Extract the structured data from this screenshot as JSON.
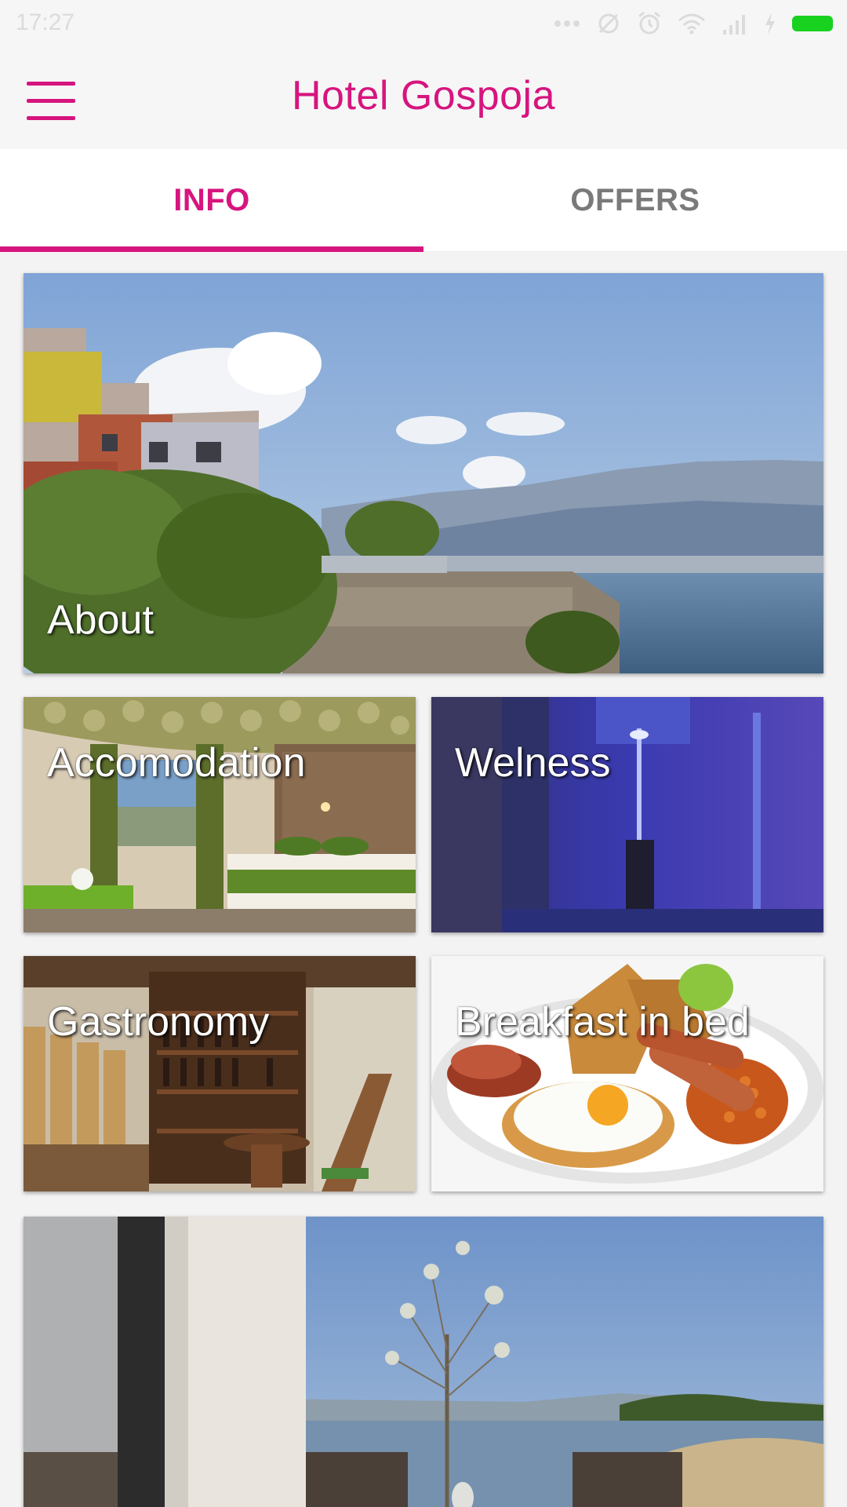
{
  "status_bar": {
    "time": "17:27",
    "icons": [
      "dots-icon",
      "sync-icon",
      "alarm-icon",
      "wifi-icon",
      "signal-icon",
      "charging-icon",
      "battery-icon"
    ],
    "battery_color": "#19d11f"
  },
  "app_bar": {
    "title": "Hotel Gospoja",
    "menu_icon": "hamburger-menu-icon"
  },
  "tabs": [
    {
      "label": "INFO",
      "selected": true
    },
    {
      "label": "OFFERS",
      "selected": false
    }
  ],
  "cards": [
    {
      "label": "About"
    },
    {
      "label": "Accomodation"
    },
    {
      "label": "Welness"
    },
    {
      "label": "Gastronomy"
    },
    {
      "label": "Breakfast in bed"
    },
    {
      "label": ""
    }
  ],
  "colors": {
    "accent": "#d6157e",
    "tab_inactive": "#7a7a7a",
    "background": "#f4f3f4"
  }
}
